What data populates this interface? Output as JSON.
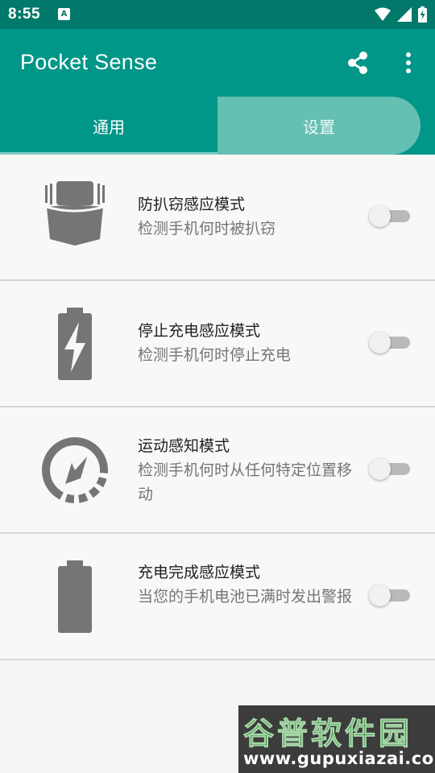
{
  "status_bar": {
    "time": "8:55",
    "notification_icon": "A"
  },
  "app_bar": {
    "title": "Pocket Sense",
    "actions": [
      "share-icon",
      "more-vert-icon"
    ]
  },
  "tabs": [
    {
      "label": "通用",
      "selected": true
    },
    {
      "label": "设置",
      "selected": false
    }
  ],
  "modes": [
    {
      "icon": "pocket-icon",
      "title": "防扒窃感应模式",
      "subtitle": "检测手机何时被扒窃",
      "enabled": false
    },
    {
      "icon": "battery-charging-icon",
      "title": "停止充电感应模式",
      "subtitle": "检测手机何时停止充电",
      "enabled": false
    },
    {
      "icon": "motion-compass-icon",
      "title": "运动感知模式",
      "subtitle": "检测手机何时从任何特定位置移动",
      "enabled": false
    },
    {
      "icon": "battery-full-icon",
      "title": "充电完成感应模式",
      "subtitle": "当您的手机电池已满时发出警报",
      "enabled": false
    }
  ],
  "colors": {
    "status_bar": "#00796b",
    "app_bar": "#009688",
    "icon_gray": "#757575"
  },
  "watermark": {
    "main": "谷普软件园",
    "url": "www.gupuxiazai.com"
  }
}
